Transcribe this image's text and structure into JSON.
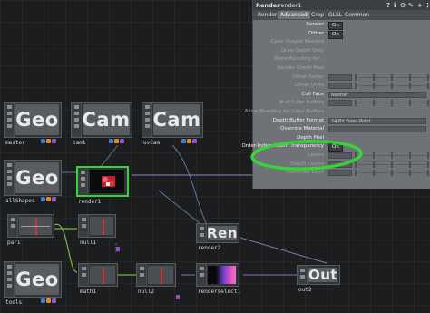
{
  "panel": {
    "title": "Render",
    "node_name": "render1",
    "tabs": [
      "Render",
      "Advanced",
      "Crop",
      "GLSL",
      "Common"
    ],
    "active_tab": "Advanced",
    "params": [
      {
        "label": "Render",
        "value": "On",
        "kind": "toggle",
        "enabled": true
      },
      {
        "label": "Dither",
        "value": "On",
        "kind": "toggle",
        "enabled": true
      },
      {
        "label": "Color Output Needed",
        "value": "",
        "kind": "blank",
        "enabled": false
      },
      {
        "label": "Draw Depth Only",
        "value": "",
        "kind": "blank",
        "enabled": false
      },
      {
        "label": "Allow Blending for...",
        "value": "",
        "kind": "blank",
        "enabled": false
      },
      {
        "label": "Render Depth Peel",
        "value": "",
        "kind": "blank",
        "enabled": false
      },
      {
        "label": "Offset Factor",
        "value": "",
        "kind": "slider",
        "enabled": false
      },
      {
        "label": "Offset Units",
        "value": "",
        "kind": "slider",
        "enabled": false
      },
      {
        "label": "Cull Face",
        "value": "Neither",
        "kind": "dropdown",
        "enabled": true
      },
      {
        "label": "# of Color Buffers",
        "value": "",
        "kind": "slider",
        "enabled": false
      },
      {
        "label": "Allow Blending for Color Buffers",
        "value": "",
        "kind": "blank",
        "enabled": false
      },
      {
        "label": "Depth Buffer Format",
        "value": "24-Bit Fixed-Point",
        "kind": "dropdown",
        "enabled": true
      },
      {
        "label": "Override Material",
        "value": "",
        "kind": "field",
        "enabled": true
      },
      {
        "label": "Depth Peel",
        "value": "",
        "kind": "blank",
        "enabled": true
      },
      {
        "label": "Order-Independent Transparency",
        "value": "On",
        "kind": "toggle",
        "enabled": true
      },
      {
        "label": "Layers",
        "value": "",
        "kind": "slider",
        "enabled": false
      },
      {
        "label": "Depth Layers",
        "value": "",
        "kind": "slider",
        "enabled": false
      },
      {
        "label": "Overdraw Limit",
        "value": "",
        "kind": "slider",
        "enabled": false
      }
    ],
    "header_icons": [
      "help-icon",
      "info-icon",
      "gear-icon",
      "script-icon",
      "plus-icon"
    ]
  },
  "network": {
    "nodes": [
      {
        "id": "master",
        "title": "Geo",
        "label": "master"
      },
      {
        "id": "cam1",
        "title": "Cam",
        "label": "cam1"
      },
      {
        "id": "uvCam",
        "title": "Cam",
        "label": "uvCam"
      },
      {
        "id": "allShapes",
        "title": "Geo",
        "label": "allShapes"
      },
      {
        "id": "render1",
        "title": "",
        "label": "render1"
      },
      {
        "id": "par1",
        "title": "",
        "label": "par1"
      },
      {
        "id": "null1",
        "title": "",
        "label": "null1"
      },
      {
        "id": "render2",
        "title": "Ren",
        "label": "render2"
      },
      {
        "id": "tools",
        "title": "Geo",
        "label": "tools"
      },
      {
        "id": "math1",
        "title": "",
        "label": "math1"
      },
      {
        "id": "null2",
        "title": "",
        "label": "null2"
      },
      {
        "id": "renderselect1",
        "title": "",
        "label": "renderselect1"
      },
      {
        "id": "out2",
        "title": "Out",
        "label": "out2"
      }
    ]
  },
  "colors": {
    "highlight": "#38d23a",
    "dot_blue": "#3d7bd6",
    "dot_orange": "#e08a2a",
    "dot_purple": "#8c54c2",
    "wire": "#7d6fb0",
    "chop_wire": "#76b842"
  }
}
